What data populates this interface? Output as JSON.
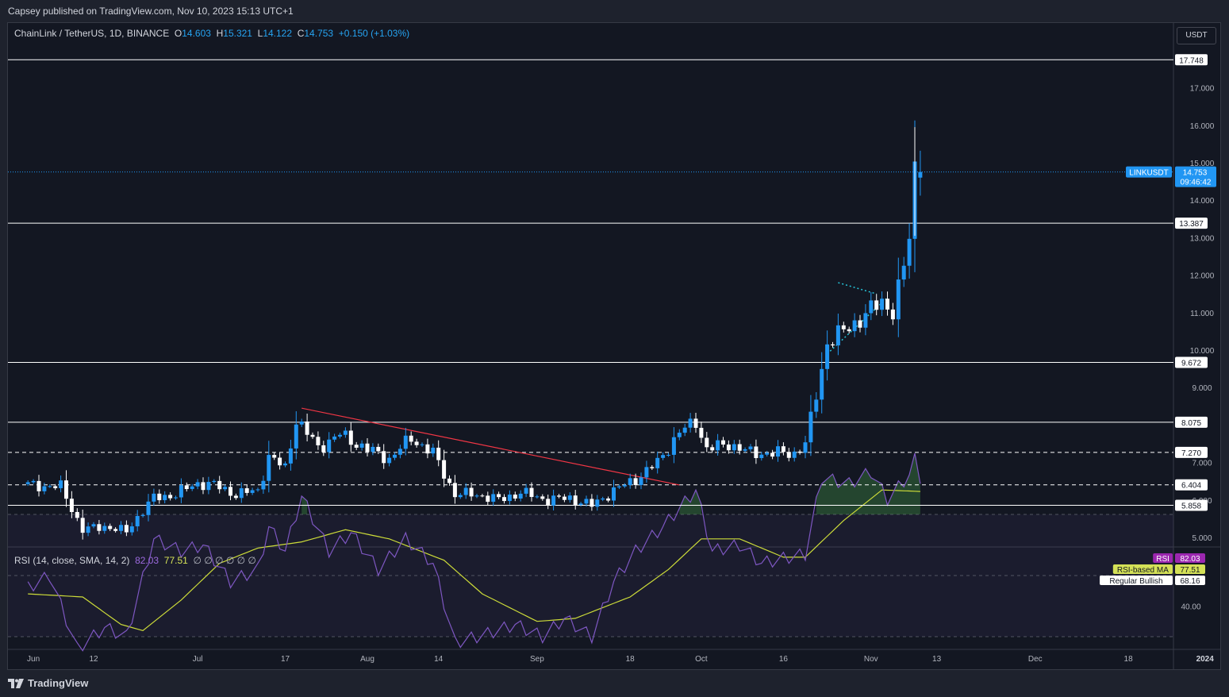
{
  "header": {
    "published": "Capsey published on TradingView.com, Nov 10, 2023 15:13 UTC+1"
  },
  "legend": {
    "symbol": "ChainLink / TetherUS, 1D, BINANCE",
    "o_label": "O",
    "o": "14.603",
    "h_label": "H",
    "h": "15.321",
    "l_label": "L",
    "l": "14.122",
    "c_label": "C",
    "c": "14.753",
    "change": "+0.150 (+1.03%)"
  },
  "currency_button": "USDT",
  "rsi_legend": {
    "text": "RSI (14, close, SMA, 14, 2)",
    "rsi": "82.03",
    "ma": "77.51",
    "icons": "∅ ∅ ∅ ∅ ∅ ∅"
  },
  "brand": "TradingView",
  "colors": {
    "up": "#2196f3",
    "down": "#ffffff",
    "rsi": "#7e57c2",
    "rsi_ma": "#cddc39",
    "trendline": "#f23645",
    "accent": "#2962ff"
  },
  "chart_data": [
    {
      "type": "candlestick",
      "symbol": "LINKUSDT",
      "price_axis": [
        "5.000",
        "6.000",
        "7.000",
        "9.000",
        "10.000",
        "11.000",
        "12.000",
        "13.000",
        "14.000",
        "15.000",
        "16.000",
        "17.000"
      ],
      "price_tags": {
        "r17748": "17.748",
        "r13387": "13.387",
        "r9672": "9.672",
        "r8075": "8.075",
        "r7270": "7.270",
        "r6404": "6.404",
        "r5858": "5.858",
        "last_label": "LINKUSDT",
        "last": "14.753",
        "countdown": "09:46:42"
      },
      "support_resistance_levels": [
        17.748,
        13.387,
        9.672,
        8.075,
        7.27,
        6.404,
        5.858
      ],
      "dashed_levels": [
        7.27,
        6.404
      ],
      "trendline": {
        "from": {
          "date": "Jul 20",
          "price": 8.45
        },
        "to": {
          "date": "Sep 27",
          "price": 6.4
        }
      },
      "x_axis": [
        "Jun",
        "12",
        "Jul",
        "17",
        "Aug",
        "14",
        "Sep",
        "18",
        "Oct",
        "16",
        "Nov",
        "13",
        "Dec",
        "18",
        "2024"
      ],
      "close_anchors": [
        [
          "May 31",
          6.4
        ],
        [
          "Jun 6",
          6.35
        ],
        [
          "Jun 10",
          5.2
        ],
        [
          "Jun 14",
          5.3
        ],
        [
          "Jun 18",
          5.15
        ],
        [
          "Jun 20",
          5.55
        ],
        [
          "Jun 23",
          6.05
        ],
        [
          "Jun 27",
          6.15
        ],
        [
          "Jul 1",
          6.45
        ],
        [
          "Jul 4",
          6.4
        ],
        [
          "Jul 8",
          6.15
        ],
        [
          "Jul 12",
          6.25
        ],
        [
          "Jul 14",
          7.15
        ],
        [
          "Jul 17",
          6.85
        ],
        [
          "Jul 19",
          8.15
        ],
        [
          "Jul 23",
          7.4
        ],
        [
          "Jul 27",
          7.75
        ],
        [
          "Aug 1",
          7.35
        ],
        [
          "Aug 5",
          7.1
        ],
        [
          "Aug 9",
          7.65
        ],
        [
          "Aug 13",
          7.25
        ],
        [
          "Aug 17",
          6.15
        ],
        [
          "Aug 21",
          6.15
        ],
        [
          "Aug 25",
          6.0
        ],
        [
          "Aug 29",
          6.2
        ],
        [
          "Sep 3",
          6.0
        ],
        [
          "Sep 7",
          6.05
        ],
        [
          "Sep 11",
          5.85
        ],
        [
          "Sep 15",
          6.25
        ],
        [
          "Sep 19",
          6.55
        ],
        [
          "Sep 23",
          7.0
        ],
        [
          "Sep 27",
          7.8
        ],
        [
          "Sep 30",
          8.1
        ],
        [
          "Oct 2",
          7.35
        ],
        [
          "Oct 6",
          7.5
        ],
        [
          "Oct 10",
          7.25
        ],
        [
          "Oct 14",
          7.25
        ],
        [
          "Oct 18",
          7.25
        ],
        [
          "Oct 20",
          7.5
        ],
        [
          "Oct 22",
          8.8
        ],
        [
          "Oct 24",
          10.2
        ],
        [
          "Oct 27",
          10.5
        ],
        [
          "Oct 31",
          10.95
        ],
        [
          "Nov 3",
          11.3
        ],
        [
          "Nov 5",
          11.05
        ],
        [
          "Nov 7",
          12.2
        ],
        [
          "Nov 8",
          13.0
        ],
        [
          "Nov 9",
          14.9
        ],
        [
          "Nov 10",
          14.753
        ]
      ],
      "last_candle": {
        "date": "Nov 10",
        "open": 14.603,
        "high": 15.321,
        "low": 14.122,
        "close": 14.753
      }
    },
    {
      "type": "line",
      "name": "RSI (14, close, SMA, 14, 2)",
      "y_axis": [
        "40.00"
      ],
      "value_tags": {
        "rsi_label": "RSI",
        "rsi": "82.03",
        "ma_label": "RSI-based MA",
        "ma": "77.51",
        "bull_label": "Regular Bullish",
        "bull": "68.16"
      },
      "rsi_anchors": [
        [
          "May 31",
          46
        ],
        [
          "Jun 4",
          50
        ],
        [
          "Jun 9",
          26
        ],
        [
          "Jun 14",
          33
        ],
        [
          "Jun 18",
          30
        ],
        [
          "Jun 23",
          62
        ],
        [
          "Jun 28",
          58
        ],
        [
          "Jul 2",
          60
        ],
        [
          "Jul 7",
          48
        ],
        [
          "Jul 12",
          52
        ],
        [
          "Jul 14",
          66
        ],
        [
          "Jul 17",
          58
        ],
        [
          "Jul 20",
          76
        ],
        [
          "Jul 25",
          58
        ],
        [
          "Jul 29",
          64
        ],
        [
          "Aug 3",
          52
        ],
        [
          "Aug 8",
          62
        ],
        [
          "Aug 13",
          54
        ],
        [
          "Aug 17",
          28
        ],
        [
          "Aug 23",
          31
        ],
        [
          "Aug 28",
          34
        ],
        [
          "Sep 2",
          30
        ],
        [
          "Sep 6",
          36
        ],
        [
          "Sep 11",
          30
        ],
        [
          "Sep 15",
          48
        ],
        [
          "Sep 19",
          58
        ],
        [
          "Sep 24",
          66
        ],
        [
          "Sep 30",
          78
        ],
        [
          "Oct 3",
          58
        ],
        [
          "Oct 8",
          60
        ],
        [
          "Oct 12",
          54
        ],
        [
          "Oct 17",
          56
        ],
        [
          "Oct 20",
          57
        ],
        [
          "Oct 23",
          82
        ],
        [
          "Oct 28",
          80
        ],
        [
          "Nov 1",
          84
        ],
        [
          "Nov 4",
          75
        ],
        [
          "Nov 8",
          83
        ],
        [
          "Nov 9",
          88
        ],
        [
          "Nov 10",
          82.03
        ]
      ],
      "ma_anchors": [
        [
          "May 31",
          44
        ],
        [
          "Jun 10",
          43
        ],
        [
          "Jun 17",
          34
        ],
        [
          "Jun 21",
          32
        ],
        [
          "Jun 28",
          42
        ],
        [
          "Jul 5",
          54
        ],
        [
          "Jul 12",
          59
        ],
        [
          "Jul 20",
          61
        ],
        [
          "Jul 28",
          65
        ],
        [
          "Aug 5",
          62
        ],
        [
          "Aug 15",
          55
        ],
        [
          "Aug 22",
          44
        ],
        [
          "Sep 1",
          35
        ],
        [
          "Sep 8",
          36
        ],
        [
          "Sep 18",
          43
        ],
        [
          "Sep 25",
          52
        ],
        [
          "Oct 1",
          62
        ],
        [
          "Oct 8",
          62
        ],
        [
          "Oct 16",
          56
        ],
        [
          "Oct 20",
          56
        ],
        [
          "Oct 27",
          68
        ],
        [
          "Nov 3",
          78
        ],
        [
          "Nov 10",
          77.51
        ]
      ],
      "bands": [
        30,
        50,
        70
      ]
    }
  ]
}
